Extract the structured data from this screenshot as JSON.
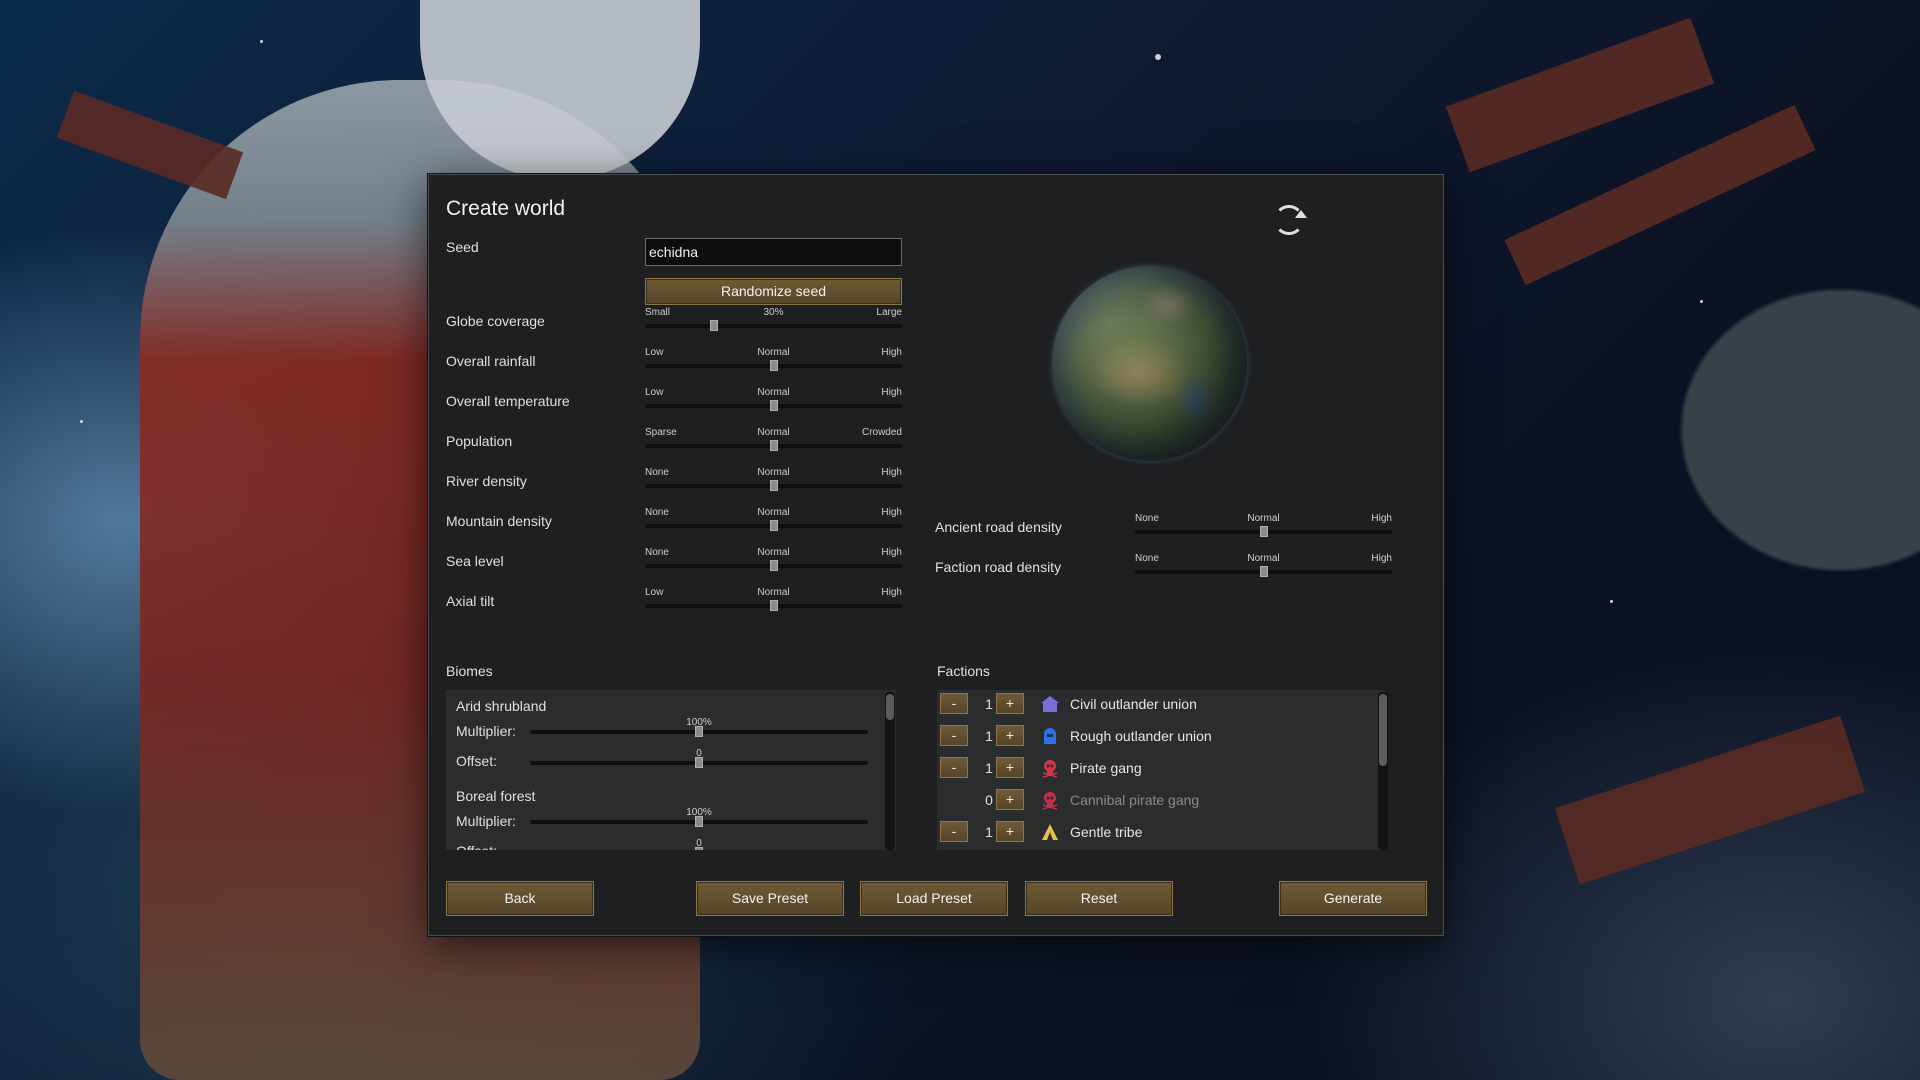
{
  "dialog": {
    "title": "Create world",
    "seed_label": "Seed",
    "seed_value": "echidna",
    "randomize_label": "Randomize seed"
  },
  "settings_left": [
    {
      "label": "Globe coverage",
      "left": "Small",
      "center": "30%",
      "right": "Large",
      "level": 0.27
    },
    {
      "label": "Overall rainfall",
      "left": "Low",
      "center": "Normal",
      "right": "High",
      "level": 0.5
    },
    {
      "label": "Overall temperature",
      "left": "Low",
      "center": "Normal",
      "right": "High",
      "level": 0.5
    },
    {
      "label": "Population",
      "left": "Sparse",
      "center": "Normal",
      "right": "Crowded",
      "level": 0.5
    },
    {
      "label": "River density",
      "left": "None",
      "center": "Normal",
      "right": "High",
      "level": 0.5
    },
    {
      "label": "Mountain density",
      "left": "None",
      "center": "Normal",
      "right": "High",
      "level": 0.5
    },
    {
      "label": "Sea level",
      "left": "None",
      "center": "Normal",
      "right": "High",
      "level": 0.5
    },
    {
      "label": "Axial tilt",
      "left": "Low",
      "center": "Normal",
      "right": "High",
      "level": 0.5
    }
  ],
  "settings_right": [
    {
      "label": "Ancient road density",
      "left": "None",
      "center": "Normal",
      "right": "High",
      "level": 0.5
    },
    {
      "label": "Faction road density",
      "left": "None",
      "center": "Normal",
      "right": "High",
      "level": 0.5
    }
  ],
  "biomes": {
    "title": "Biomes",
    "multiplier_label": "Multiplier:",
    "offset_label": "Offset:",
    "items": [
      {
        "name": "Arid shrubland",
        "multiplier": "100%",
        "offset": "0",
        "multiplier_level": 0.5,
        "offset_level": 0.5
      },
      {
        "name": "Boreal forest",
        "multiplier": "100%",
        "offset": "0",
        "multiplier_level": 0.5,
        "offset_level": 0.5
      }
    ]
  },
  "factions": {
    "title": "Factions",
    "minus": "-",
    "plus": "+",
    "items": [
      {
        "count": "1",
        "name": "Civil outlander union",
        "icon": "house-icon",
        "color": "#7a6fd6",
        "enabled": true
      },
      {
        "count": "1",
        "name": "Rough outlander union",
        "icon": "helmet-icon",
        "color": "#2a72e8",
        "enabled": true
      },
      {
        "count": "1",
        "name": "Pirate gang",
        "icon": "skull-icon",
        "color": "#d2354a",
        "enabled": true
      },
      {
        "count": "0",
        "name": "Cannibal pirate gang",
        "icon": "skull-icon",
        "color": "#c0304a",
        "enabled": false
      },
      {
        "count": "1",
        "name": "Gentle tribe",
        "icon": "tent-icon",
        "color": "#e6c24a",
        "enabled": true
      }
    ]
  },
  "buttons": {
    "back": "Back",
    "save_preset": "Save Preset",
    "load_preset": "Load Preset",
    "reset": "Reset",
    "generate": "Generate"
  },
  "colors": {
    "button_brown": "#6e5a35",
    "panel_bg": "#1d1f21"
  }
}
